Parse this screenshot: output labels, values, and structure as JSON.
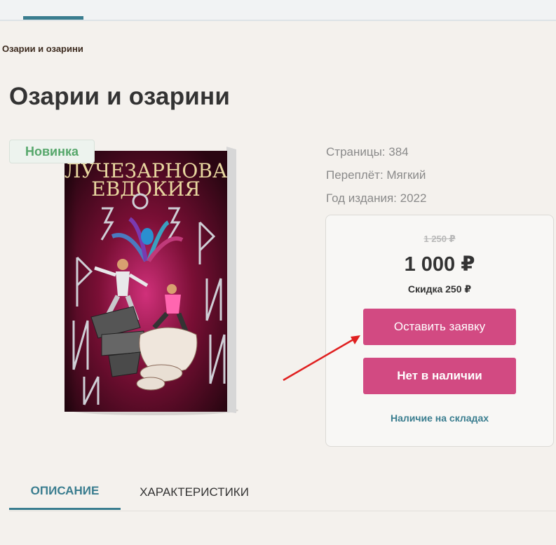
{
  "breadcrumb": "Озарии и озарини",
  "page_title": "Озарии и озарини",
  "badge": "Новинка",
  "specs": {
    "pages": "Страницы: 384",
    "binding": "Переплёт: Мягкий",
    "year": "Год издания: 2022"
  },
  "price": {
    "old": "1 250 ₽",
    "current": "1 000 ₽",
    "discount": "Скидка 250 ₽"
  },
  "buttons": {
    "request": "Оставить заявку",
    "out_of_stock": "Нет в наличии"
  },
  "stock_link": "Наличие на складах",
  "tabs": [
    "ОПИСАНИЕ",
    "ХАРАКТЕРИСТИКИ"
  ],
  "cover": {
    "author_line1": "ЛУЧЕЗАРНОВА",
    "author_line2": "ЕВДОКИЯ"
  },
  "colors": {
    "accent": "#d24a82",
    "link": "#3a7d8f",
    "badge_text": "#56a76b",
    "arrow": "#e02020"
  }
}
